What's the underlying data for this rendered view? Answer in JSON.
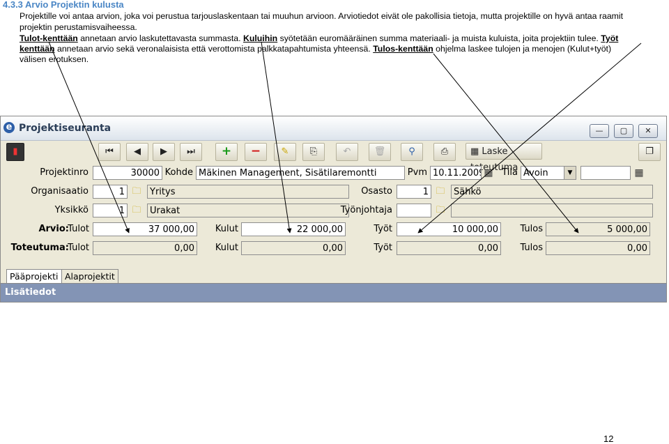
{
  "doc": {
    "heading": "4.3.3 Arvio Projektin kulusta",
    "p1": "Projektille voi antaa arvion, joka voi perustua tarjouslaskentaan tai muuhun arvioon. Arviotiedot eivät ole pakollisia tietoja, mutta projektille on hyvä antaa raamit",
    "p2": "projektin perustamisvaiheessa.",
    "p3_u1": "Tulot-kenttään",
    "p3_t1": " annetaan arvio laskutettavasta summasta. ",
    "p3_u2": "Kuluihin",
    "p3_t2": " syötetään euromääräinen summa materiaali- ja muista kuluista, joita projektiin tulee. ",
    "p3_u3": "Työt",
    "p4_u1": "kenttään",
    "p4_t1": " annetaan arvio sekä veronalaisista että verottomista palkkatapahtumista yhteensä. ",
    "p4_u2": "Tulos-kenttään",
    "p4_t2": " ohjelma laskee tulojen ja menojen (Kulut+työt)",
    "p5": "välisen erotuksen.",
    "page_number": "12"
  },
  "window": {
    "title": "Projektiseuranta",
    "app_icon": "e",
    "toolbar_calc_label": "Laske toteutuma"
  },
  "form": {
    "projektinro_label": "Projektinro",
    "projektinro": "30000",
    "kohde_label": "Kohde",
    "kohde": "Mäkinen Management, Sisätilaremontti",
    "pvm_label": "Pvm",
    "pvm": "10.11.2009",
    "tila_label": "Tila",
    "tila": "Avoin",
    "organisaatio_label": "Organisaatio",
    "organisaatio_no": "1",
    "organisaatio": "Yritys",
    "osasto_label": "Osasto",
    "osasto_no": "1",
    "osasto": "Sähkö",
    "yksikko_label": "Yksikkö",
    "yksikko_no": "1",
    "yksikko": "Urakat",
    "tyonjohtaja_label": "Työnjohtaja",
    "arvio_label": "Arvio:",
    "toteutuma_label": "Toteutuma:",
    "tulot_label": "Tulot",
    "kulut_label": "Kulut",
    "tyot_label": "Työt",
    "tulos_label": "Tulos",
    "arvio": {
      "tulot": "37 000,00",
      "kulut": "22 000,00",
      "tyot": "10 000,00",
      "tulos": "5 000,00"
    },
    "toteutuma": {
      "tulot": "0,00",
      "kulut": "0,00",
      "tyot": "0,00",
      "tulos": "0,00"
    }
  },
  "tabs": [
    "Pääprojekti",
    "Alaprojektit"
  ],
  "subheader": "Lisätiedot"
}
